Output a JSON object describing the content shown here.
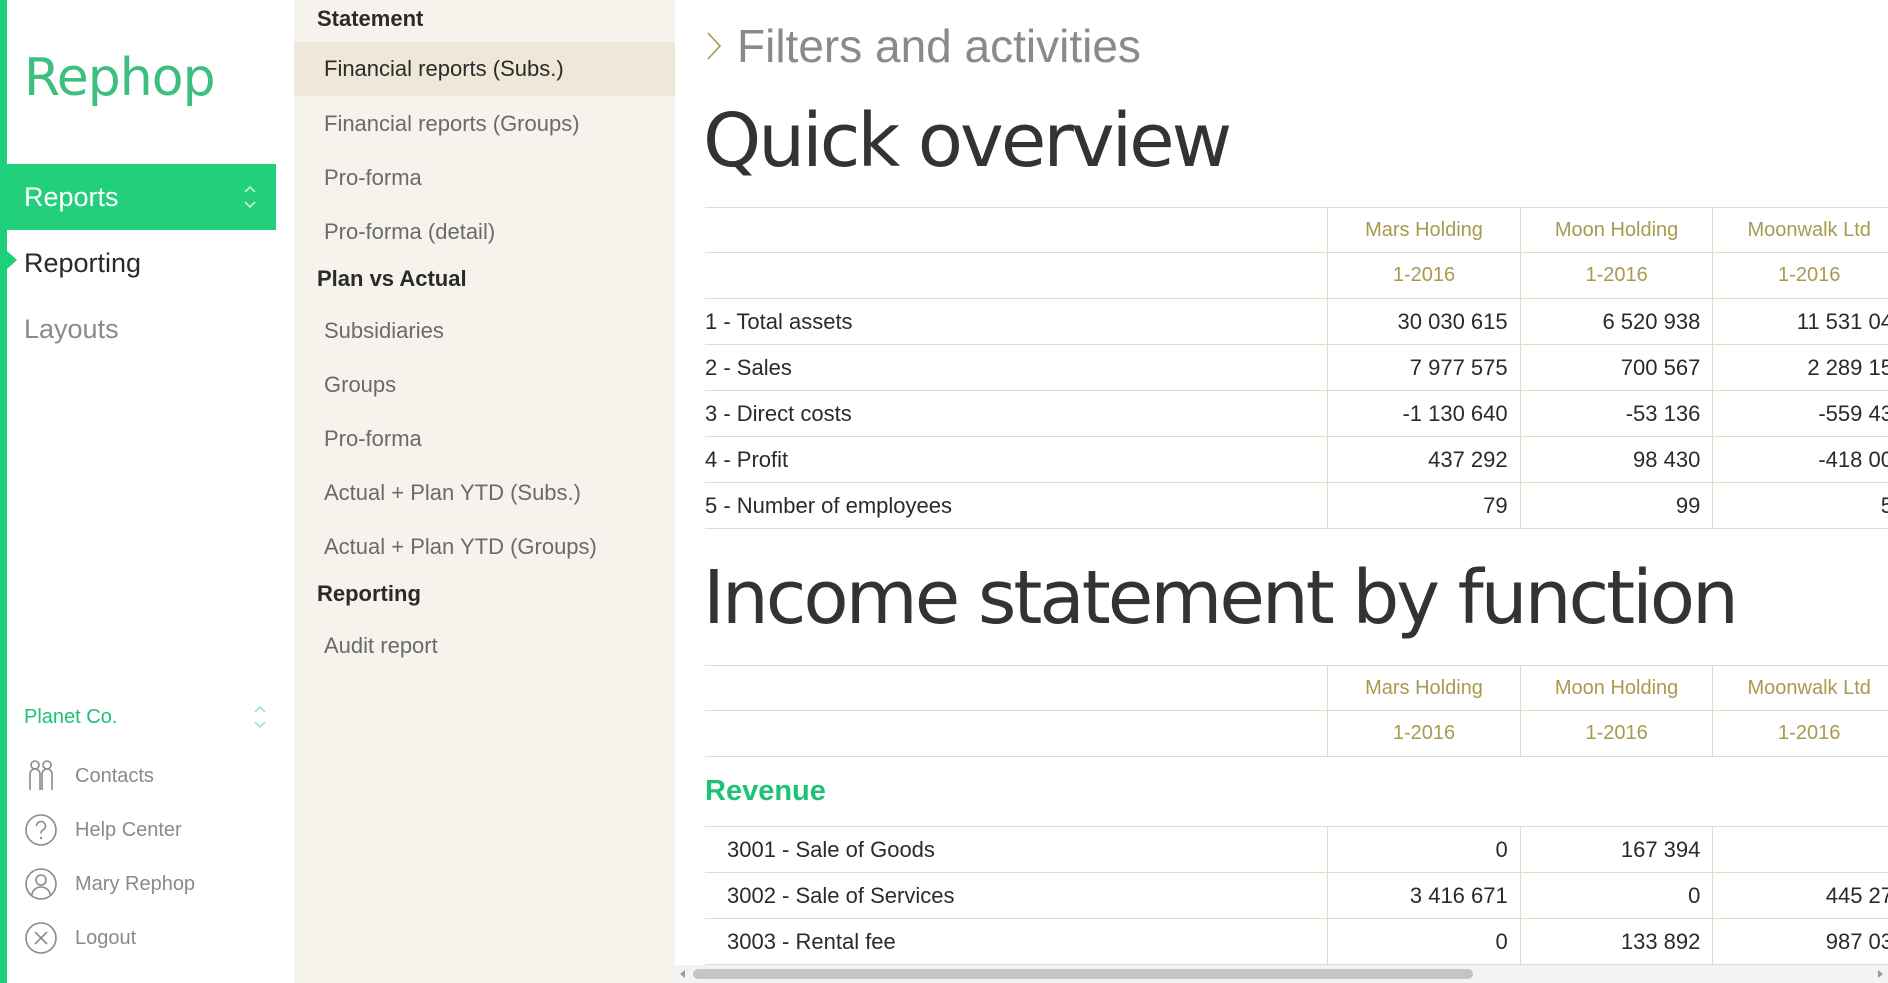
{
  "app": {
    "logo_text": "Rephop",
    "accent_color": "#1ed07a",
    "gold_color": "#a89a4e"
  },
  "nav": {
    "items": [
      {
        "label": "Reports",
        "state": "active"
      },
      {
        "label": "Reporting",
        "state": "current"
      },
      {
        "label": "Layouts",
        "state": "normal"
      }
    ]
  },
  "footer": {
    "company": "Planet Co.",
    "items": [
      {
        "label": "Contacts",
        "icon": "contacts-icon"
      },
      {
        "label": "Help Center",
        "icon": "help-icon"
      },
      {
        "label": "Mary Rephop",
        "icon": "user-icon"
      },
      {
        "label": "Logout",
        "icon": "logout-icon"
      }
    ]
  },
  "submenu": {
    "groups": [
      {
        "heading": "Statement",
        "items": [
          {
            "label": "Financial reports (Subs.)",
            "selected": true
          },
          {
            "label": "Financial reports (Groups)",
            "selected": false
          },
          {
            "label": "Pro-forma",
            "selected": false
          },
          {
            "label": "Pro-forma (detail)",
            "selected": false
          }
        ]
      },
      {
        "heading": "Plan vs Actual",
        "items": [
          {
            "label": "Subsidiaries",
            "selected": false
          },
          {
            "label": "Groups",
            "selected": false
          },
          {
            "label": "Pro-forma",
            "selected": false
          },
          {
            "label": "Actual + Plan YTD (Subs.)",
            "selected": false
          },
          {
            "label": "Actual + Plan YTD (Groups)",
            "selected": false
          }
        ]
      },
      {
        "heading": "Reporting",
        "items": [
          {
            "label": "Audit report",
            "selected": false
          }
        ]
      }
    ]
  },
  "main": {
    "filters_label": "Filters and activities",
    "quick_overview": {
      "title": "Quick overview",
      "columns": [
        {
          "name": "Mars Holding",
          "period": "1-2016"
        },
        {
          "name": "Moon Holding",
          "period": "1-2016"
        },
        {
          "name": "Moonwalk Ltd",
          "period": "1-2016"
        }
      ],
      "rows": [
        {
          "label": "1 - Total assets",
          "values": [
            "30 030 615",
            "6 520 938",
            "11 531 04"
          ]
        },
        {
          "label": "2 - Sales",
          "values": [
            "7 977 575",
            "700 567",
            "2 289 15"
          ]
        },
        {
          "label": "3 - Direct costs",
          "values": [
            "-1 130 640",
            "-53 136",
            "-559 43"
          ]
        },
        {
          "label": "4 - Profit",
          "values": [
            "437 292",
            "98 430",
            "-418 00"
          ]
        },
        {
          "label": "5 - Number of employees",
          "values": [
            "79",
            "99",
            "5"
          ]
        }
      ]
    },
    "income_statement": {
      "title": "Income statement by function",
      "columns": [
        {
          "name": "Mars Holding",
          "period": "1-2016"
        },
        {
          "name": "Moon Holding",
          "period": "1-2016"
        },
        {
          "name": "Moonwalk Ltd",
          "period": "1-2016"
        }
      ],
      "group": "Revenue",
      "rows": [
        {
          "label": "3001 - Sale of Goods",
          "values": [
            "0",
            "167 394",
            ""
          ]
        },
        {
          "label": "3002 - Sale of Services",
          "values": [
            "3 416 671",
            "0",
            "445 27"
          ]
        },
        {
          "label": "3003 - Rental fee",
          "values": [
            "0",
            "133 892",
            "987 03"
          ]
        }
      ]
    }
  }
}
